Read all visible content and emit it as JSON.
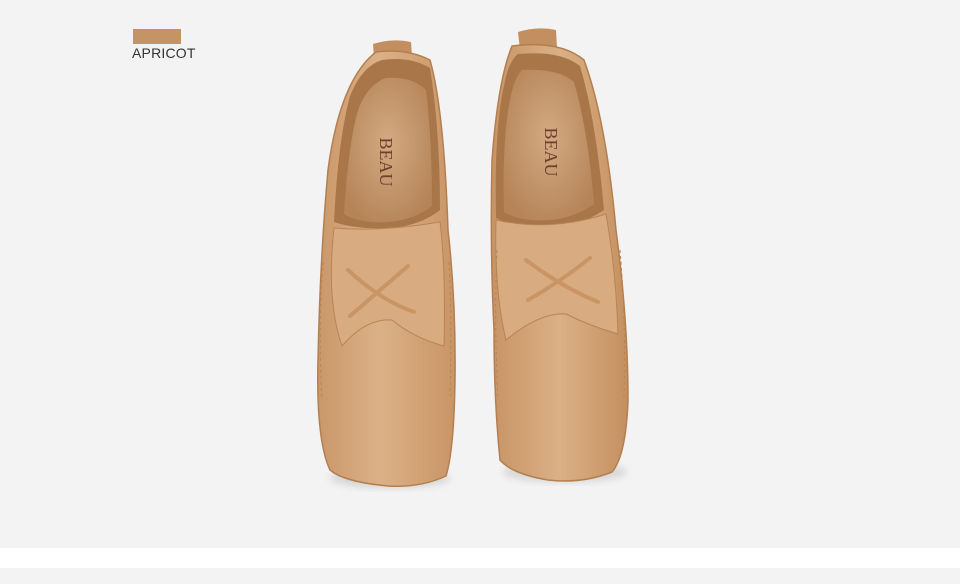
{
  "color_option": {
    "label": "APRICOT",
    "swatch_color": "#c49466"
  },
  "product": {
    "insole_brand_left": "BEAU",
    "insole_brand_right": "BEAU",
    "leather_color": "#d4a77a",
    "insole_color": "#c79a6f"
  }
}
